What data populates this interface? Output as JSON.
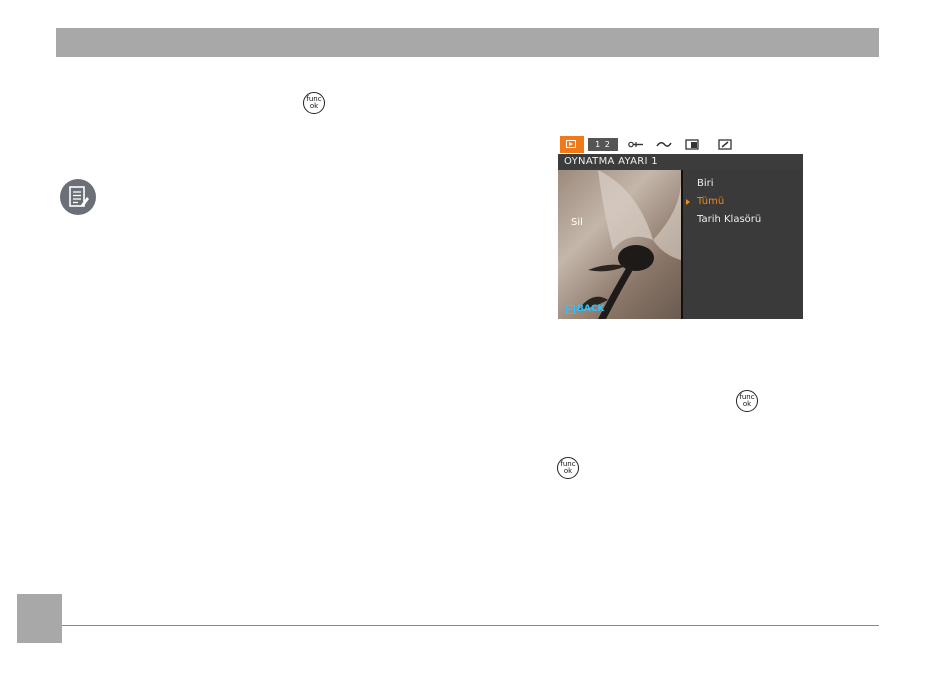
{
  "camera_screen": {
    "tabs": {
      "page_indicator": "1 2",
      "icons": [
        "playback-icon",
        "scissors-icon",
        "redo-icon",
        "slideshow-icon",
        "edit-icon"
      ]
    },
    "section_title": "OYNATMA AYARI 1",
    "left_label": "Sil",
    "back_label": "BACK",
    "menu_items": [
      "Biri",
      "Tümü",
      "Tarih Klasörü"
    ],
    "selected_index": 1,
    "colors": {
      "accent": "#ee7a1a",
      "back": "#2ec3ff",
      "panel": "#3a3a3a"
    }
  },
  "buttons": {
    "func_top": "func",
    "func_bottom": "ok"
  },
  "colors": {
    "header_bar": "#a8a8a8",
    "footer_box": "#a8a8a8"
  }
}
